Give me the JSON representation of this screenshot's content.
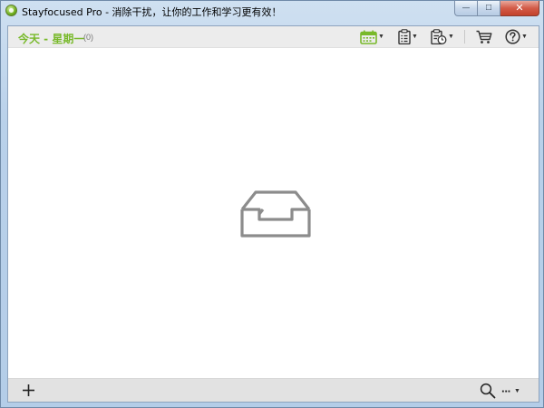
{
  "window": {
    "title": "Stayfocused Pro - 消除干扰，让你的工作和学习更有效！",
    "minimize_glyph": "—",
    "maximize_glyph": "□",
    "close_glyph": "✕"
  },
  "header": {
    "day_label": "今天 - 星期一",
    "count": "(0)"
  },
  "toolbar": {
    "icons": [
      "calendar-icon",
      "clipboard-list-icon",
      "clipboard-clock-icon",
      "cart-icon",
      "help-icon"
    ],
    "accent_color": "#78b92a"
  },
  "empty_state": {
    "icon": "empty-inbox-icon"
  },
  "footer": {
    "add_glyph": "+",
    "more_glyph": "···"
  }
}
